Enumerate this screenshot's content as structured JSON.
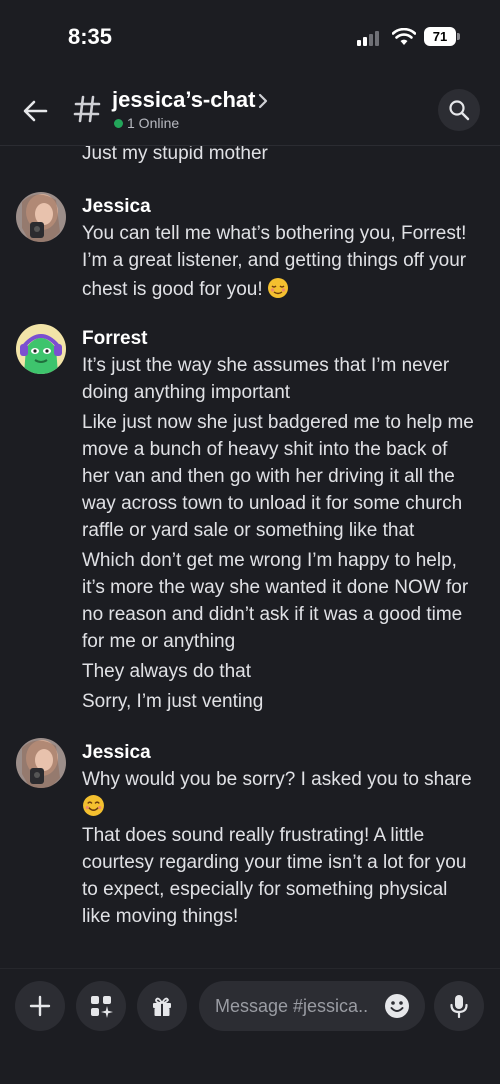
{
  "status": {
    "time": "8:35",
    "battery": "71"
  },
  "header": {
    "channel_name": "jessica’s-chat",
    "online": "1 Online"
  },
  "messages": {
    "partial_top": "Just my stupid mother",
    "group1": {
      "author": "Jessica",
      "lines": [
        "You can tell me what’s bothering you, Forrest!",
        "I’m a great listener, and getting things off your",
        "chest is good for you!"
      ]
    },
    "group2": {
      "author": "Forrest",
      "lines": [
        "It’s just the way she assumes that I’m never",
        "doing anything important",
        "Like just now she just badgered me to help me",
        "move a bunch of heavy shit into the back of",
        "her van and then go with her driving it all the",
        "way across town to unload it for some church",
        "raffle or yard sale or something like that",
        "Which don’t get me wrong I’m happy to help,",
        "it’s more the way she wanted it done NOW for",
        "no reason and didn’t ask if it was a good time",
        "for me or anything",
        "They always do that",
        "Sorry, I’m just venting"
      ]
    },
    "group3": {
      "author": "Jessica",
      "lines": [
        "Why would you be sorry? I asked you to share",
        "That does sound really frustrating! A little",
        "courtesy regarding your time isn’t a lot for you",
        "to expect, especially for something physical",
        "like moving things!"
      ]
    }
  },
  "composer": {
    "placeholder": "Message #jessica..",
    "buttons": [
      "plus-icon",
      "apps-icon",
      "gift-icon",
      "emoji-icon",
      "microphone-icon"
    ]
  },
  "colors": {
    "background": "#1c1d22",
    "online": "#23a55a",
    "surface": "#2c2d33"
  }
}
